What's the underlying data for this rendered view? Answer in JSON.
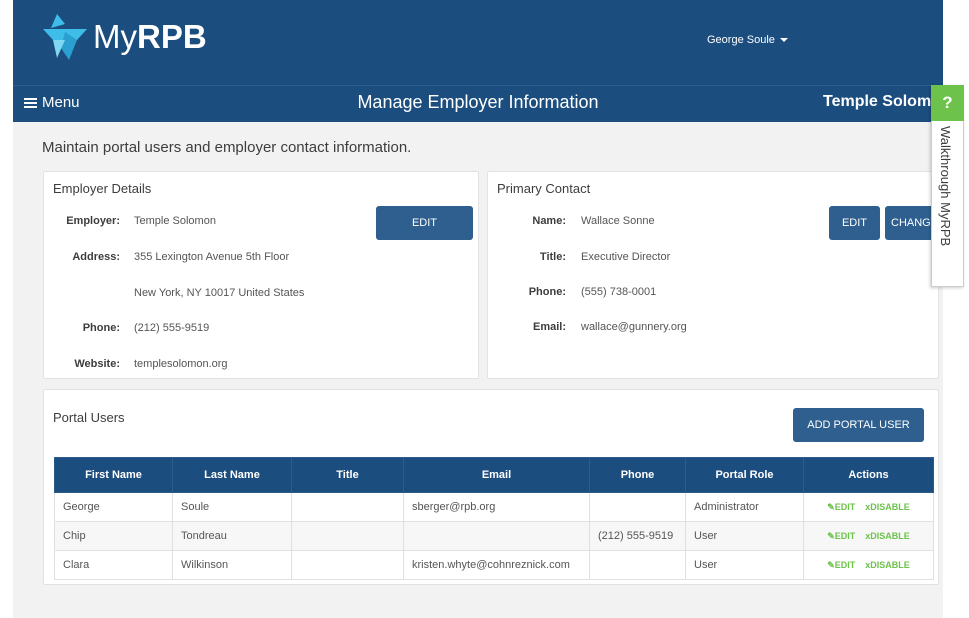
{
  "header": {
    "logo_my": "My",
    "logo_rpb": "RPB",
    "user_name": "George Soule"
  },
  "navbar": {
    "menu_label": "Menu",
    "page_title": "Manage Employer Information",
    "org_name": "Temple Solomon"
  },
  "help": {
    "question_mark": "?",
    "label": "Walkthrough MyRPB"
  },
  "intro": "Maintain portal users and employer contact information.",
  "employer_details": {
    "title": "Employer Details",
    "edit_label": "EDIT",
    "fields": {
      "employer_label": "Employer:",
      "employer_value": "Temple Solomon",
      "address_label": "Address:",
      "address_line1": "355 Lexington Avenue 5th Floor",
      "address_line2": "New York, NY 10017 United States",
      "phone_label": "Phone:",
      "phone_value": "(212) 555-9519",
      "website_label": "Website:",
      "website_value": "templesolomon.org"
    }
  },
  "primary_contact": {
    "title": "Primary Contact",
    "edit_label": "EDIT",
    "change_label": "CHANGE",
    "fields": {
      "name_label": "Name:",
      "name_value": "Wallace Sonne",
      "title_label": "Title:",
      "title_value": "Executive Director",
      "phone_label": "Phone:",
      "phone_value": "(555) 738-0001",
      "email_label": "Email:",
      "email_value": "wallace@gunnery.org"
    }
  },
  "portal_users": {
    "title": "Portal Users",
    "add_label": "ADD PORTAL USER",
    "columns": [
      "First Name",
      "Last Name",
      "Title",
      "Email",
      "Phone",
      "Portal Role",
      "Actions"
    ],
    "edit_action": "EDIT",
    "disable_action": "DISABLE",
    "rows": [
      {
        "first": "George",
        "last": "Soule",
        "title": "",
        "email": "sberger@rpb.org",
        "phone": "",
        "role": "Administrator"
      },
      {
        "first": "Chip",
        "last": "Tondreau",
        "title": "",
        "email": "",
        "phone": "(212) 555-9519",
        "role": "User"
      },
      {
        "first": "Clara",
        "last": "Wilkinson",
        "title": "",
        "email": "kristen.whyte@cohnreznick.com",
        "phone": "",
        "role": "User"
      }
    ]
  },
  "colors": {
    "header_bg": "#1c4d7f",
    "button_bg": "#2e5f8e",
    "action_green": "#6dc24b",
    "content_bg": "#f2f2f2"
  }
}
